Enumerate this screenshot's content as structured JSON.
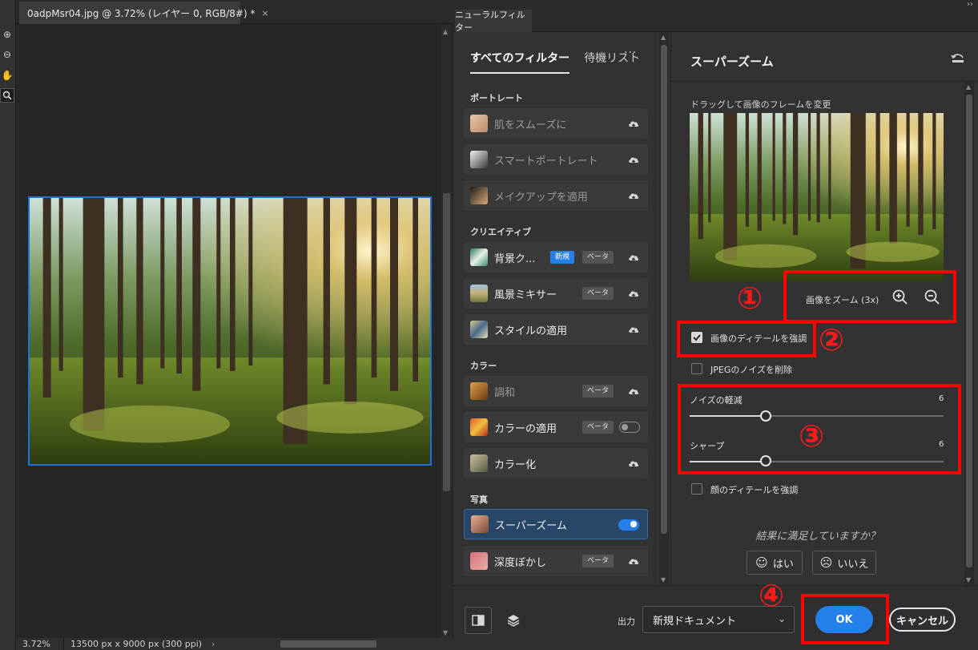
{
  "document": {
    "tab_title": "0adpMsr04.jpg @ 3.72% (レイヤー 0, RGB/8#) *",
    "close_glyph": "×",
    "zoom": "3.72%",
    "dimensions": "13500 px x 9000 px (300 ppi)",
    "status_arrow": "›"
  },
  "panel": {
    "tab_title": "ニューラルフィルター",
    "collapse_glyph": "››",
    "tabs": {
      "all": "すべてのフィルター",
      "waitlist": "待機リスト",
      "more": "···"
    },
    "categories": {
      "portrait": "ポートレート",
      "creative": "クリエイティブ",
      "color": "カラー",
      "photo": "写真"
    },
    "filters": [
      {
        "label": "肌をスムーズに"
      },
      {
        "label": "スマートポートレート"
      },
      {
        "label": "メイクアップを適用"
      },
      {
        "label": "背景ク...",
        "badge_new": "新規",
        "badge_beta": "ベータ"
      },
      {
        "label": "風景ミキサー",
        "badge_beta": "ベータ"
      },
      {
        "label": "スタイルの適用"
      },
      {
        "label": "調和",
        "badge_beta": "ベータ"
      },
      {
        "label": "カラーの適用",
        "badge_beta": "ベータ"
      },
      {
        "label": "カラー化"
      },
      {
        "label": "スーパーズーム"
      },
      {
        "label": "深度ぼかし",
        "badge_beta": "ベータ"
      }
    ]
  },
  "settings": {
    "title": "スーパーズーム",
    "description": "ドラッグして画像のフレームを変更",
    "zoom_label": "画像をズーム (3x)",
    "enhance_detail": "画像のディテールを強調",
    "remove_jpeg_noise": "JPEGのノイズを削除",
    "noise_reduction": {
      "label": "ノイズの軽減",
      "value": "6",
      "level": 0.3
    },
    "sharpen": {
      "label": "シャープ",
      "value": "6",
      "level": 0.3
    },
    "enhance_face": "顔のディテールを強調",
    "satisfaction_prompt": "結果に満足していますか？",
    "yes": "はい",
    "no": "いいえ"
  },
  "footer": {
    "output_label": "出力",
    "output_value": "新規ドキュメント",
    "ok": "OK",
    "cancel": "キャンセル"
  },
  "annotations": [
    "①",
    "②",
    "③",
    "④"
  ],
  "colors": {
    "accent": "#2680eb",
    "annotation": "#ff0000",
    "panel_bg": "#323232"
  }
}
